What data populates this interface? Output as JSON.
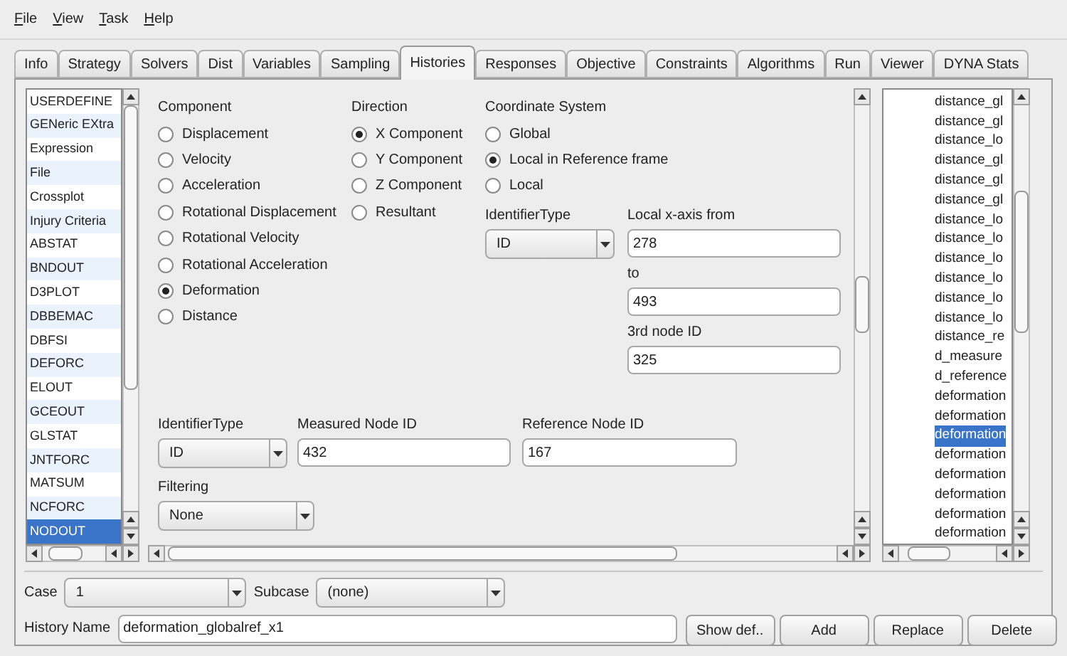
{
  "menu": [
    "File",
    "View",
    "Task",
    "Help"
  ],
  "tabs": [
    {
      "label": "Info",
      "selected": false
    },
    {
      "label": "Strategy",
      "selected": false
    },
    {
      "label": "Solvers",
      "selected": false
    },
    {
      "label": "Dist",
      "selected": false
    },
    {
      "label": "Variables",
      "selected": false
    },
    {
      "label": "Sampling",
      "selected": false
    },
    {
      "label": "Histories",
      "selected": true
    },
    {
      "label": "Responses",
      "selected": false
    },
    {
      "label": "Objective",
      "selected": false
    },
    {
      "label": "Constraints",
      "selected": false
    },
    {
      "label": "Algorithms",
      "selected": false
    },
    {
      "label": "Run",
      "selected": false
    },
    {
      "label": "Viewer",
      "selected": false
    },
    {
      "label": "DYNA Stats",
      "selected": false
    }
  ],
  "history_types": [
    {
      "label": "USERDEFINE",
      "selected": false
    },
    {
      "label": "GENeric EXtra",
      "selected": false
    },
    {
      "label": "Expression",
      "selected": false
    },
    {
      "label": "File",
      "selected": false
    },
    {
      "label": "Crossplot",
      "selected": false
    },
    {
      "label": "Injury Criteria",
      "selected": false
    },
    {
      "label": "ABSTAT",
      "selected": false
    },
    {
      "label": "BNDOUT",
      "selected": false
    },
    {
      "label": "D3PLOT",
      "selected": false
    },
    {
      "label": "DBBEMAC",
      "selected": false
    },
    {
      "label": "DBFSI",
      "selected": false
    },
    {
      "label": "DEFORC",
      "selected": false
    },
    {
      "label": "ELOUT",
      "selected": false
    },
    {
      "label": "GCEOUT",
      "selected": false
    },
    {
      "label": "GLSTAT",
      "selected": false
    },
    {
      "label": "JNTFORC",
      "selected": false
    },
    {
      "label": "MATSUM",
      "selected": false
    },
    {
      "label": "NCFORC",
      "selected": false
    },
    {
      "label": "NODOUT",
      "selected": true
    }
  ],
  "component": {
    "title": "Component",
    "options": [
      {
        "label": "Displacement",
        "selected": false
      },
      {
        "label": "Velocity",
        "selected": false
      },
      {
        "label": "Acceleration",
        "selected": false
      },
      {
        "label": "Rotational Displacement",
        "selected": false
      },
      {
        "label": "Rotational Velocity",
        "selected": false
      },
      {
        "label": "Rotational Acceleration",
        "selected": false
      },
      {
        "label": "Deformation",
        "selected": true
      },
      {
        "label": "Distance",
        "selected": false
      }
    ]
  },
  "direction": {
    "title": "Direction",
    "options": [
      {
        "label": "X Component",
        "selected": true
      },
      {
        "label": "Y Component",
        "selected": false
      },
      {
        "label": "Z Component",
        "selected": false
      },
      {
        "label": "Resultant",
        "selected": false
      }
    ]
  },
  "coordinate_system": {
    "title": "Coordinate System",
    "options": [
      {
        "label": "Global",
        "selected": false
      },
      {
        "label": "Local",
        "selected": false
      }
    ],
    "local_ref": {
      "label": "Local in Reference frame",
      "selected": true
    },
    "identifier_type": {
      "label": "IdentifierType",
      "value": "ID"
    },
    "fields": [
      {
        "label": "Local x-axis from",
        "value": "278"
      },
      {
        "label": "to",
        "value": "493"
      },
      {
        "label": "3rd node ID",
        "value": "325"
      }
    ]
  },
  "node_identifier_type": {
    "label": "IdentifierType",
    "value": "ID"
  },
  "measured_node": {
    "label": "Measured Node ID",
    "value": "432"
  },
  "reference_node": {
    "label": "Reference Node ID",
    "value": "167"
  },
  "filtering": {
    "label": "Filtering",
    "value": "None"
  },
  "histories": [
    {
      "label": "distance_gl",
      "selected": false
    },
    {
      "label": "distance_gl",
      "selected": false
    },
    {
      "label": "distance_lo",
      "selected": false
    },
    {
      "label": "distance_gl",
      "selected": false
    },
    {
      "label": "distance_gl",
      "selected": false
    },
    {
      "label": "distance_gl",
      "selected": false
    },
    {
      "label": "distance_lo",
      "selected": false
    },
    {
      "label": "distance_lo",
      "selected": false
    },
    {
      "label": "distance_lo",
      "selected": false
    },
    {
      "label": "distance_lo",
      "selected": false
    },
    {
      "label": "distance_lo",
      "selected": false
    },
    {
      "label": "distance_lo",
      "selected": false
    },
    {
      "label": "distance_re",
      "selected": false
    },
    {
      "label": "d_measure",
      "selected": false
    },
    {
      "label": "d_reference",
      "selected": false
    },
    {
      "label": "deformation",
      "selected": false
    },
    {
      "label": "deformation",
      "selected": false
    },
    {
      "label": "deformation",
      "selected": true
    },
    {
      "label": "deformation",
      "selected": false
    },
    {
      "label": "deformation",
      "selected": false
    },
    {
      "label": "deformation",
      "selected": false
    },
    {
      "label": "deformation",
      "selected": false
    },
    {
      "label": "deformation",
      "selected": false
    }
  ],
  "case": {
    "label": "Case",
    "value": "1"
  },
  "subcase": {
    "label": "Subcase",
    "value": "(none)"
  },
  "history_name": {
    "label": "History Name",
    "value": "deformation_globalref_x1"
  },
  "buttons": [
    "Show def..",
    "Add",
    "Replace",
    "Delete"
  ]
}
